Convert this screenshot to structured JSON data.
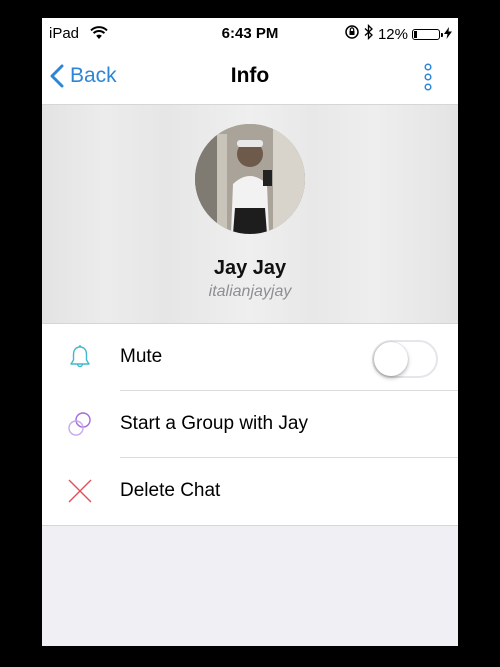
{
  "status_bar": {
    "carrier": "iPad",
    "time": "6:43 PM",
    "battery_text": "12%",
    "battery_level": 0.12
  },
  "navbar": {
    "back_label": "Back",
    "title": "Info"
  },
  "profile": {
    "name": "Jay Jay",
    "handle": "italianjayjay"
  },
  "actions": [
    {
      "label": "Mute",
      "icon": "bell-icon",
      "toggle": false
    },
    {
      "label": "Start a Group with Jay",
      "icon": "group-circles-icon"
    },
    {
      "label": "Delete Chat",
      "icon": "delete-x-icon"
    }
  ],
  "colors": {
    "accent": "#2d86d6",
    "mute_icon": "#3fb8cf",
    "group_icon": "#a46ad9",
    "delete_icon": "#e0525b"
  }
}
